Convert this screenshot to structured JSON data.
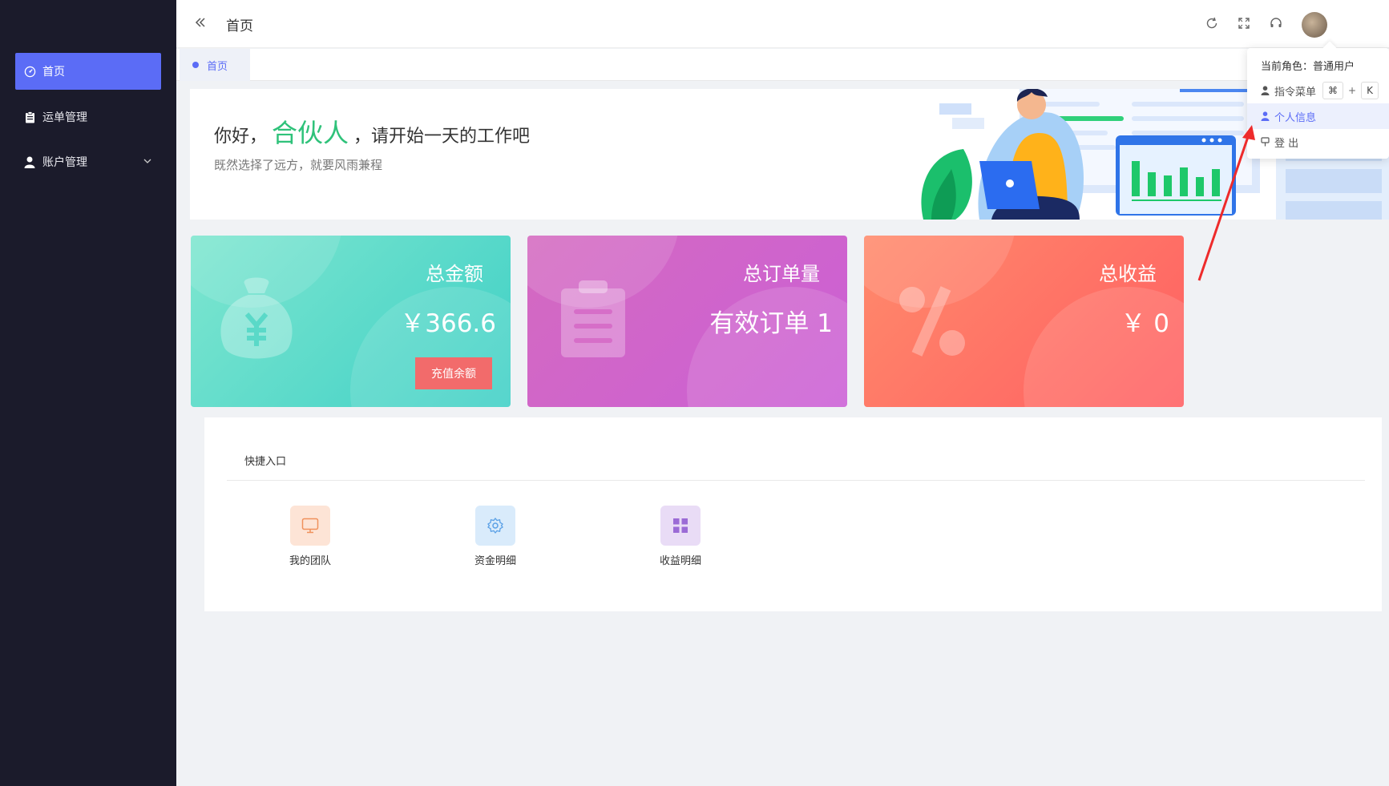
{
  "sidebar": {
    "items": [
      {
        "label": "首页",
        "icon": "dashboard-icon",
        "active": true
      },
      {
        "label": "运单管理",
        "icon": "clipboard-icon"
      },
      {
        "label": "账户管理",
        "icon": "user-icon",
        "has_submenu": true
      }
    ]
  },
  "header": {
    "title": "首页",
    "icons": [
      "refresh-icon",
      "fullscreen-icon",
      "headset-icon",
      "avatar"
    ]
  },
  "tabs": [
    {
      "label": "首页",
      "active": true
    }
  ],
  "welcome": {
    "greeting_prefix": "你好，",
    "greeting_name": "合伙人",
    "greeting_suffix": "，请开始一天的工作吧",
    "subtitle": "既然选择了远方，就要风雨兼程"
  },
  "cards": [
    {
      "title": "总金额",
      "value": "￥366.6",
      "button": "充值余额",
      "icon": "money-bag-icon",
      "colors": [
        "#7ee6cf",
        "#3fd0c6"
      ]
    },
    {
      "title": "总订单量",
      "value": "有效订单 1",
      "icon": "clipboard-icon",
      "colors": [
        "#d46ac0",
        "#cb5fd6"
      ]
    },
    {
      "title": "总收益",
      "value": "￥ 0",
      "icon": "percent-icon",
      "colors": [
        "#ff8a6b",
        "#ff5f62"
      ]
    }
  ],
  "quick_entry": {
    "title": "快捷入口",
    "items": [
      {
        "label": "我的团队",
        "icon": "monitor-icon",
        "bg": "#fde4d6",
        "color": "#f0915c"
      },
      {
        "label": "资金明细",
        "icon": "gear-icon",
        "bg": "#d9ebfb",
        "color": "#5aa0e6"
      },
      {
        "label": "收益明细",
        "icon": "grid-icon",
        "bg": "#e9dcf6",
        "color": "#9b6bd6"
      }
    ]
  },
  "dropdown": {
    "role_label": "当前角色：",
    "role_value": "普通用户",
    "items": [
      {
        "label": "指令菜单",
        "icon": "user-icon",
        "shortcut": [
          "⌘",
          "+",
          "K"
        ]
      },
      {
        "label": "个人信息",
        "icon": "user-icon",
        "active": true
      },
      {
        "label": "登 出",
        "icon": "logout-icon"
      }
    ]
  },
  "colors": {
    "sidebar_bg": "#1b1b2b",
    "accent": "#5b6cf6",
    "greeting_highlight": "#2fc27a",
    "annotation_arrow": "#ee2b2b"
  }
}
